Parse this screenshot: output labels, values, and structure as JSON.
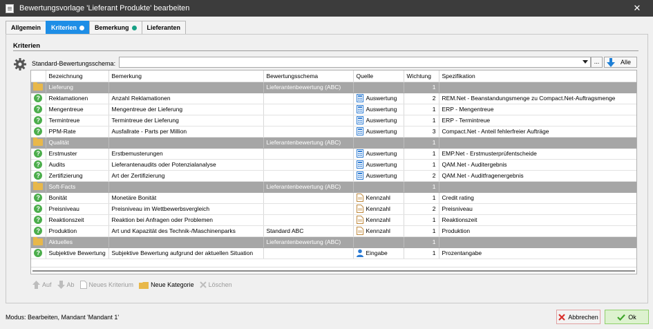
{
  "window": {
    "title": "Bewertungsvorlage 'Lieferant Produkte' bearbeiten",
    "close_glyph": "✕"
  },
  "tabs": [
    {
      "label": "Allgemein",
      "active": false,
      "dot": null
    },
    {
      "label": "Kriterien",
      "active": true,
      "dot": "#ffffff"
    },
    {
      "label": "Bemerkung",
      "active": false,
      "dot": "#16a085"
    },
    {
      "label": "Lieferanten",
      "active": false,
      "dot": null
    }
  ],
  "section": {
    "title": "Kriterien"
  },
  "schema": {
    "label": "Standard-Bewertungsschema:",
    "value": "",
    "dots_label": "...",
    "alle_label": "Alle"
  },
  "grid": {
    "columns": [
      "",
      "Bezeichnung",
      "Bemerkung",
      "Bewertungsschema",
      "Quelle",
      "Wichtung",
      "Spezifikation"
    ],
    "rows": [
      {
        "type": "category",
        "name": "Lieferung",
        "remark": "",
        "schema": "Lieferantenbewertung (ABC)",
        "source": "",
        "source_icon": "",
        "weight": "1",
        "spec": ""
      },
      {
        "type": "item",
        "name": "Reklamationen",
        "remark": "Anzahl Reklamationen",
        "schema": "",
        "source": "Auswertung",
        "source_icon": "calc",
        "weight": "2",
        "spec": "REM.Net - Beanstandungsmenge zu Compact.Net-Auftragsmenge"
      },
      {
        "type": "item",
        "name": "Mengentreue",
        "remark": "Mengentreue der Lieferung",
        "schema": "",
        "source": "Auswertung",
        "source_icon": "calc",
        "weight": "1",
        "spec": "ERP - Mengentreue"
      },
      {
        "type": "item",
        "name": "Termintreue",
        "remark": "Termintreue der Lieferung",
        "schema": "",
        "source": "Auswertung",
        "source_icon": "calc",
        "weight": "1",
        "spec": "ERP - Termintreue"
      },
      {
        "type": "item",
        "name": "PPM-Rate",
        "remark": "Ausfallrate - Parts per Million",
        "schema": "",
        "source": "Auswertung",
        "source_icon": "calc",
        "weight": "3",
        "spec": "Compact.Net - Anteil fehlerfreier Aufträge"
      },
      {
        "type": "category",
        "name": "Qualität",
        "remark": "",
        "schema": "Lieferantenbewertung (ABC)",
        "source": "",
        "source_icon": "",
        "weight": "1",
        "spec": ""
      },
      {
        "type": "item",
        "name": "Erstmuster",
        "remark": "Erstbemusterungen",
        "schema": "",
        "source": "Auswertung",
        "source_icon": "calc",
        "weight": "1",
        "spec": "EMP.Net - Erstmusterprüfentscheide"
      },
      {
        "type": "item",
        "name": "Audits",
        "remark": "Lieferantenaudits oder Potenzialanalyse",
        "schema": "",
        "source": "Auswertung",
        "source_icon": "calc",
        "weight": "1",
        "spec": "QAM.Net - Auditergebnis"
      },
      {
        "type": "item",
        "name": "Zertifizierung",
        "remark": "Art der Zertifizierung",
        "schema": "",
        "source": "Auswertung",
        "source_icon": "calc",
        "weight": "2",
        "spec": "QAM.Net - Auditfragenergebnis"
      },
      {
        "type": "category",
        "name": "Soft-Facts",
        "remark": "",
        "schema": "Lieferantenbewertung (ABC)",
        "source": "",
        "source_icon": "",
        "weight": "1",
        "spec": ""
      },
      {
        "type": "item",
        "name": "Bonität",
        "remark": "Monetäre Bonität",
        "schema": "",
        "source": "Kennzahl",
        "source_icon": "doc",
        "weight": "1",
        "spec": "Credit rating"
      },
      {
        "type": "item",
        "name": "Preisniveau",
        "remark": "Preisniveau im Wettbewerbsvergleich",
        "schema": "",
        "source": "Kennzahl",
        "source_icon": "doc",
        "weight": "2",
        "spec": "Preisniveau"
      },
      {
        "type": "item",
        "name": "Reaktionszeit",
        "remark": "Reaktion bei Anfragen oder Problemen",
        "schema": "",
        "source": "Kennzahl",
        "source_icon": "doc",
        "weight": "1",
        "spec": "Reaktionszeit"
      },
      {
        "type": "item",
        "name": "Produktion",
        "remark": "Art und Kapazität des Technik-/Maschinenparks",
        "schema": "Standard ABC",
        "source": "Kennzahl",
        "source_icon": "doc",
        "weight": "1",
        "spec": "Produktion"
      },
      {
        "type": "category",
        "name": "Aktuelles",
        "remark": "",
        "schema": "Lieferantenbewertung (ABC)",
        "source": "",
        "source_icon": "",
        "weight": "1",
        "spec": ""
      },
      {
        "type": "item",
        "name": "Subjektive Bewertung",
        "remark": "Subjektive Bewertung aufgrund der aktuellen Situation",
        "schema": "",
        "source": "Eingabe",
        "source_icon": "user",
        "weight": "1",
        "spec": "Prozentangabe"
      }
    ]
  },
  "toolbar": {
    "up": "Auf",
    "down": "Ab",
    "new_criterion": "Neues Kriterium",
    "new_category": "Neue Kategorie",
    "delete": "Löschen"
  },
  "status": {
    "text": "Modus: Bearbeiten, Mandant 'Mandant 1'"
  },
  "buttons": {
    "cancel": "Abbrechen",
    "ok": "Ok"
  }
}
